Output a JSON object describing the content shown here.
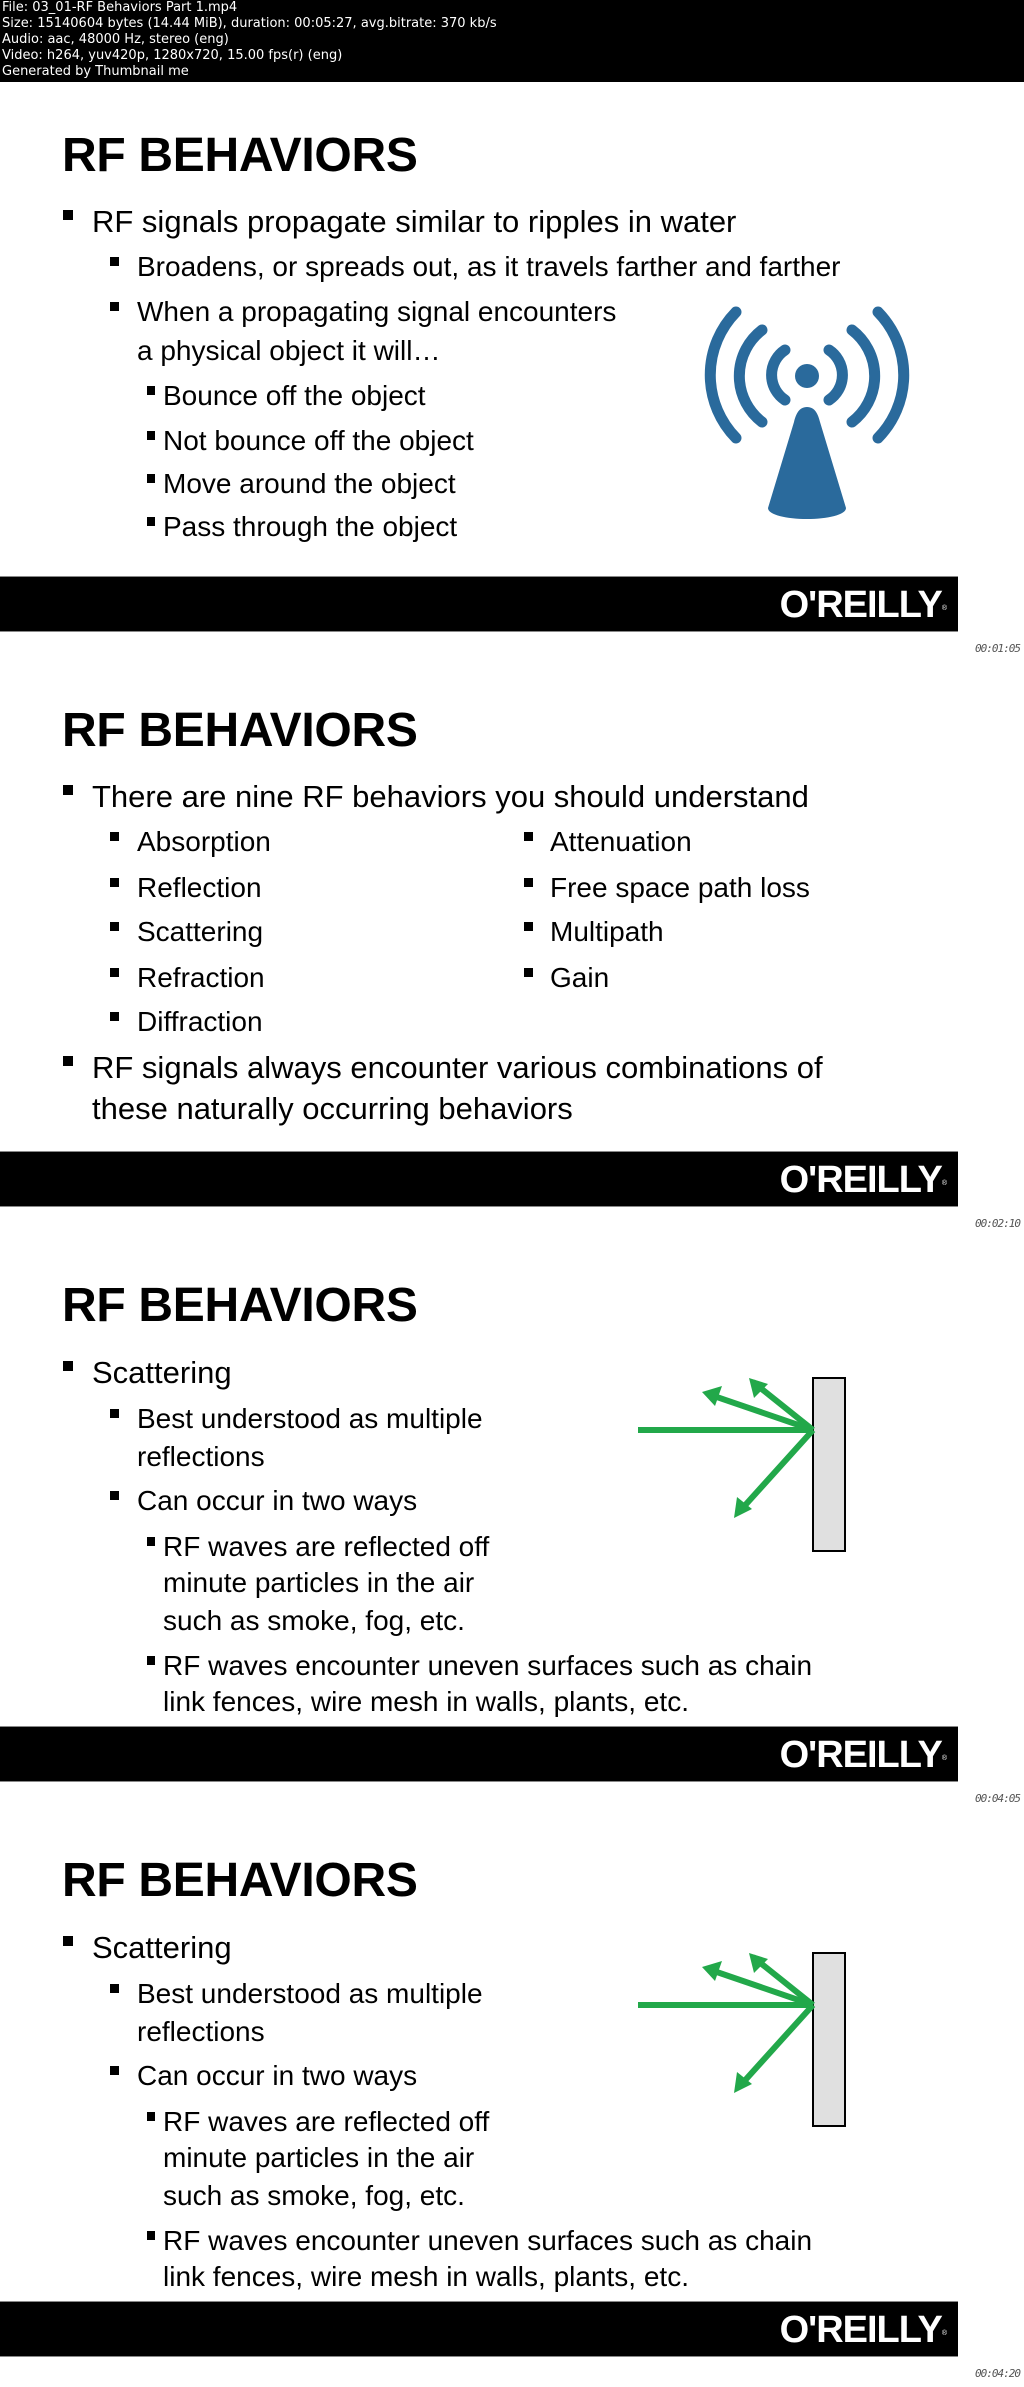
{
  "info_header": {
    "lines": [
      "File: 03_01-RF Behaviors Part  1.mp4",
      "Size: 15140604 bytes (14.44 MiB), duration: 00:05:27, avg.bitrate: 370 kb/s",
      "Audio: aac, 48000 Hz, stereo (eng)",
      "Video: h264, yuv420p, 1280x720, 15.00 fps(r) (eng)",
      "Generated by Thumbnail me"
    ]
  },
  "brand": {
    "logo_text": "O'REILLY",
    "trademark": "®"
  },
  "colors": {
    "icon_blue": "#2a6a9c",
    "arrow_green": "#22a84a",
    "wall_fill": "#e0e0e0",
    "bar": "#000000"
  },
  "slides": [
    {
      "title": "RF BEHAVIORS",
      "timestamp": "00:01:05",
      "bullets": [
        "RF signals propagate similar to ripples in water",
        "Broadens, or spreads out, as it travels farther and farther",
        "When a propagating signal encounters",
        "a physical object it will…",
        "Bounce off the object",
        "Not bounce off the object",
        "Move around the object",
        "Pass through the object"
      ],
      "icon": "wireless-tower-icon"
    },
    {
      "title": "RF BEHAVIORS",
      "timestamp": "00:02:10",
      "intro": "There are nine RF behaviors you should understand",
      "left_column": [
        "Absorption",
        "Reflection",
        "Scattering",
        "Refraction",
        "Diffraction"
      ],
      "right_column": [
        "Attenuation",
        "Free space path loss",
        "Multipath",
        "Gain"
      ],
      "closing": [
        "RF signals always encounter various combinations of",
        "these naturally occurring behaviors"
      ]
    },
    {
      "title": "RF BEHAVIORS",
      "timestamp": "00:04:05",
      "topic": "Scattering",
      "lines": [
        "Best understood as multiple",
        "reflections",
        "Can occur in two ways",
        "RF waves are reflected off",
        "minute particles in the air",
        "such as smoke, fog, etc.",
        "RF waves encounter uneven surfaces such as chain",
        "link fences, wire mesh in walls, plants, etc."
      ],
      "diagram": "scattering-diagram"
    },
    {
      "title": "RF BEHAVIORS",
      "timestamp": "00:04:20",
      "topic": "Scattering",
      "lines": [
        "Best understood as multiple",
        "reflections",
        "Can occur in two ways",
        "RF waves are reflected off",
        "minute particles in the air",
        "such as smoke, fog, etc.",
        "RF waves encounter uneven surfaces such as chain",
        "link fences, wire mesh in walls, plants, etc."
      ],
      "diagram": "scattering-diagram"
    }
  ]
}
